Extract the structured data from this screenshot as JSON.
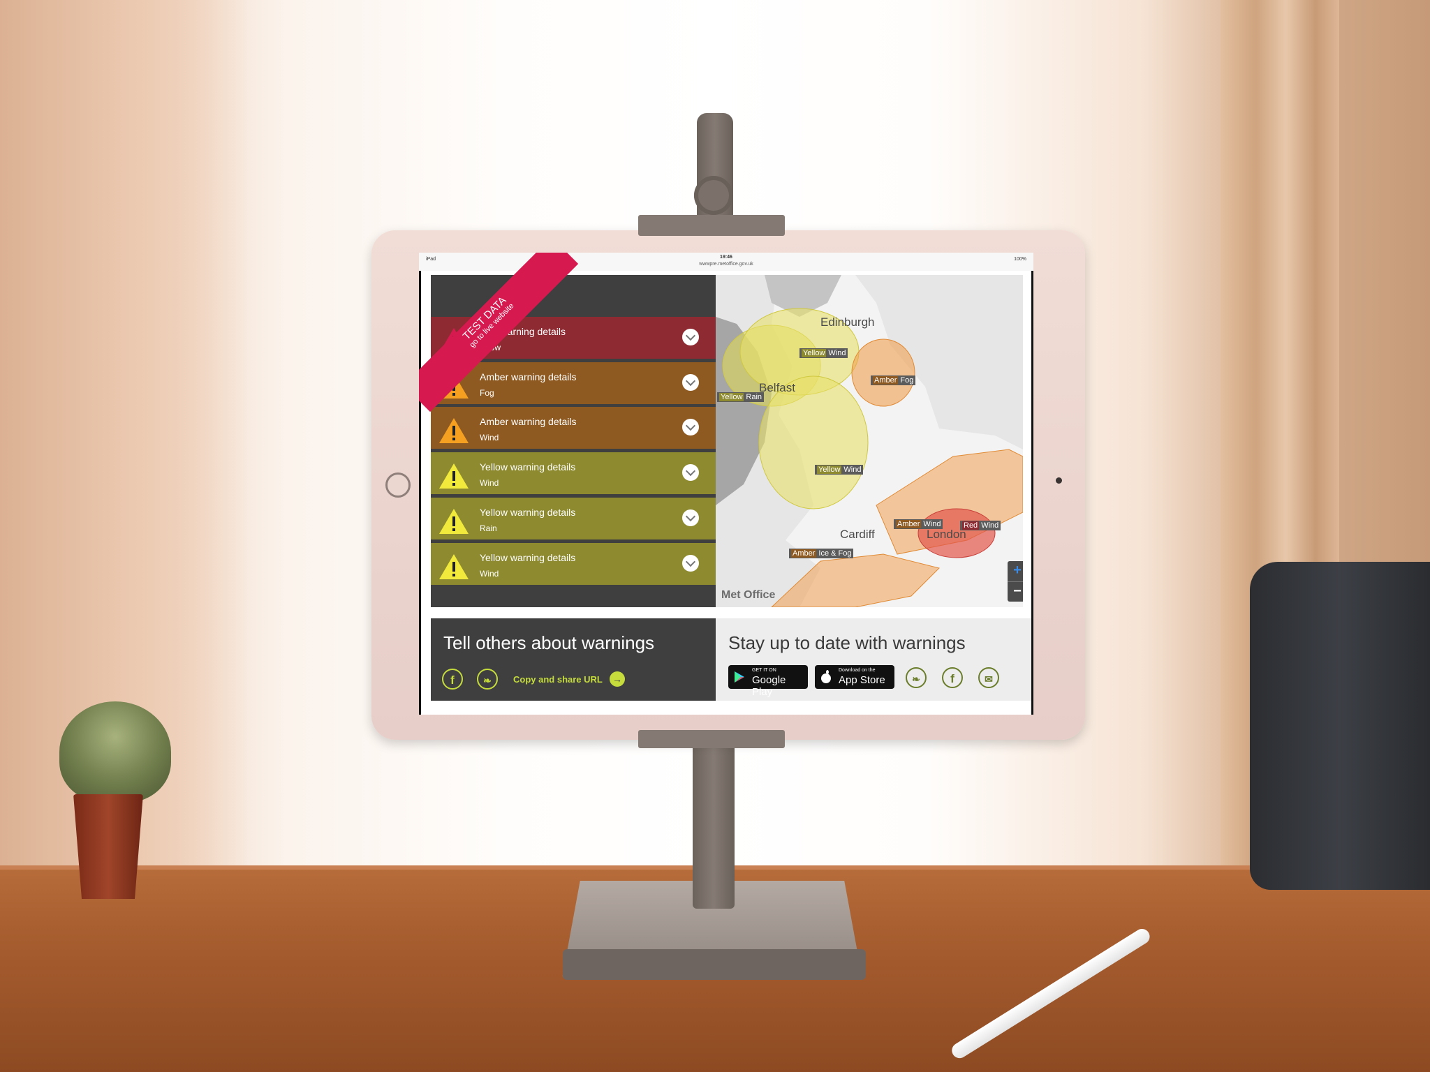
{
  "device": {
    "status_left": "iPad",
    "time": "19:46",
    "url": "wwwpre.metoffice.gov.uk",
    "battery": "100%"
  },
  "ribbon": {
    "line1": "TEST DATA",
    "line2": "go to live website"
  },
  "warnings": [
    {
      "title": "Red warning details",
      "sub": "Snow",
      "color": "#8e2b32"
    },
    {
      "title": "Amber warning details",
      "sub": "Fog",
      "color": "#8f5a21"
    },
    {
      "title": "Amber warning details",
      "sub": "Wind",
      "color": "#8f5a21"
    },
    {
      "title": "Yellow warning details",
      "sub": "Wind",
      "color": "#8d8a2f"
    },
    {
      "title": "Yellow warning details",
      "sub": "Rain",
      "color": "#8d8a2f"
    },
    {
      "title": "Yellow warning details",
      "sub": "Wind",
      "color": "#8d8a2f"
    }
  ],
  "map": {
    "cities": [
      "Edinburgh",
      "Belfast",
      "Cardiff",
      "London"
    ],
    "labels": [
      {
        "sev": "Yellow",
        "type": "Wind"
      },
      {
        "sev": "Amber",
        "type": "Fog"
      },
      {
        "sev": "Yellow",
        "type": "Rain"
      },
      {
        "sev": "Yellow",
        "type": "Wind"
      },
      {
        "sev": "Amber",
        "type": "Wind"
      },
      {
        "sev": "Red",
        "type": "Wind"
      },
      {
        "sev": "Amber",
        "type": "Ice & Fog"
      }
    ],
    "zoom_in": "+",
    "zoom_out": "−",
    "logo": "Met Office"
  },
  "footer": {
    "left_heading": "Tell others about warnings",
    "copy_label": "Copy and share URL",
    "right_heading": "Stay up to date with warnings",
    "google_small": "GET IT ON",
    "google_big": "Google Play",
    "apple_small": "Download on the",
    "apple_big": "App Store"
  },
  "colors": {
    "red": "#8e2b32",
    "amber": "#8f5a21",
    "yellow": "#8d8a2f",
    "accent": "#c5dc3c",
    "ribbon": "#d61a50"
  }
}
